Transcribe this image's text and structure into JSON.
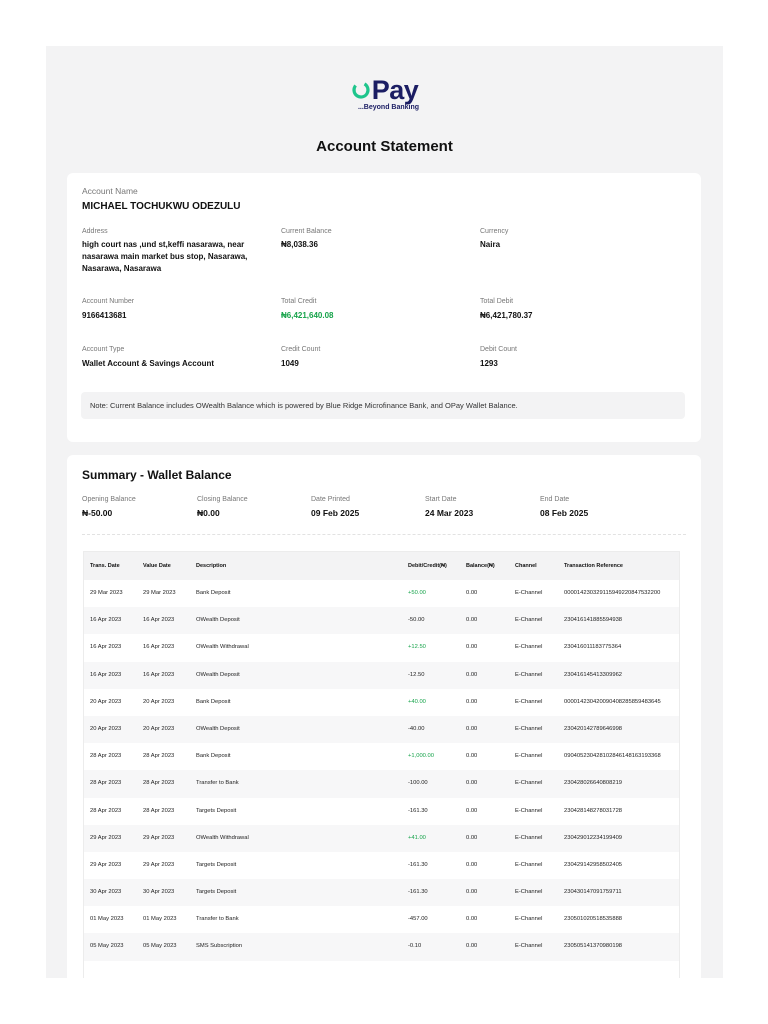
{
  "logo": {
    "word": "Pay",
    "tagline": "...Beyond Banking",
    "brand_color": "#1b1d63",
    "accent_color": "#1ec58c"
  },
  "page_title": "Account Statement",
  "account": {
    "name_label": "Account Name",
    "name": "MICHAEL TOCHUKWU ODEZULU",
    "address_label": "Address",
    "address_lines": [
      "high court nas ,und st,keffi nasarawa, near",
      "nasarawa main market bus stop, Nasarawa,",
      "Nasarawa, Nasarawa"
    ],
    "current_balance_label": "Current Balance",
    "current_balance": "₦8,038.36",
    "currency_label": "Currency",
    "currency": "Naira",
    "account_number_label": "Account Number",
    "account_number": "9166413681",
    "total_credit_label": "Total Credit",
    "total_credit": "₦6,421,640.08",
    "total_debit_label": "Total Debit",
    "total_debit": "₦6,421,780.37",
    "account_type_label": "Account Type",
    "account_type": "Wallet Account & Savings Account",
    "credit_count_label": "Credit Count",
    "credit_count": "1049",
    "debit_count_label": "Debit Count",
    "debit_count": "1293",
    "note": "Note: Current Balance includes OWealth Balance which is powered by Blue Ridge Microfinance Bank, and OPay Wallet Balance."
  },
  "summary": {
    "title": "Summary - Wallet Balance",
    "opening_balance_label": "Opening Balance",
    "opening_balance": "₦-50.00",
    "closing_balance_label": "Closing Balance",
    "closing_balance": "₦0.00",
    "date_printed_label": "Date Printed",
    "date_printed": "09 Feb 2025",
    "start_date_label": "Start Date",
    "start_date": "24 Mar 2023",
    "end_date_label": "End Date",
    "end_date": "08 Feb 2025"
  },
  "table": {
    "headers": [
      "Trans. Date",
      "Value Date",
      "Description",
      "Debit/Credit(₦)",
      "Balance(₦)",
      "Channel",
      "Transaction Reference"
    ],
    "rows": [
      {
        "trans_date": "29 Mar 2023",
        "value_date": "29 Mar 2023",
        "description": "Bank Deposit",
        "amount": "+50.00",
        "balance": "0.00",
        "channel": "E-Channel",
        "reference": "000014230329115949220847532200",
        "credit": true
      },
      {
        "trans_date": "16 Apr 2023",
        "value_date": "16 Apr 2023",
        "description": "OWealth Deposit",
        "amount": "-50.00",
        "balance": "0.00",
        "channel": "E-Channel",
        "reference": "230416141885594938",
        "credit": false
      },
      {
        "trans_date": "16 Apr 2023",
        "value_date": "16 Apr 2023",
        "description": "OWealth Withdrawal",
        "amount": "+12.50",
        "balance": "0.00",
        "channel": "E-Channel",
        "reference": "230416011183775364",
        "credit": true
      },
      {
        "trans_date": "16 Apr 2023",
        "value_date": "16 Apr 2023",
        "description": "OWealth Deposit",
        "amount": "-12.50",
        "balance": "0.00",
        "channel": "E-Channel",
        "reference": "230416145413309962",
        "credit": false
      },
      {
        "trans_date": "20 Apr 2023",
        "value_date": "20 Apr 2023",
        "description": "Bank Deposit",
        "amount": "+40.00",
        "balance": "0.00",
        "channel": "E-Channel",
        "reference": "000014230420090408285859483645",
        "credit": true
      },
      {
        "trans_date": "20 Apr 2023",
        "value_date": "20 Apr 2023",
        "description": "OWealth Deposit",
        "amount": "-40.00",
        "balance": "0.00",
        "channel": "E-Channel",
        "reference": "230420142789646998",
        "credit": false
      },
      {
        "trans_date": "28 Apr 2023",
        "value_date": "28 Apr 2023",
        "description": "Bank Deposit",
        "amount": "+1,000.00",
        "balance": "0.00",
        "channel": "E-Channel",
        "reference": "090405230428102846148163193368",
        "credit": true
      },
      {
        "trans_date": "28 Apr 2023",
        "value_date": "28 Apr 2023",
        "description": "Transfer to Bank",
        "amount": "-100.00",
        "balance": "0.00",
        "channel": "E-Channel",
        "reference": "230428026640808219",
        "credit": false
      },
      {
        "trans_date": "28 Apr 2023",
        "value_date": "28 Apr 2023",
        "description": "Targets Deposit",
        "amount": "-161.30",
        "balance": "0.00",
        "channel": "E-Channel",
        "reference": "230428148278031728",
        "credit": false
      },
      {
        "trans_date": "29 Apr 2023",
        "value_date": "29 Apr 2023",
        "description": "OWealth Withdrawal",
        "amount": "+41.00",
        "balance": "0.00",
        "channel": "E-Channel",
        "reference": "230429012234199409",
        "credit": true
      },
      {
        "trans_date": "29 Apr 2023",
        "value_date": "29 Apr 2023",
        "description": "Targets Deposit",
        "amount": "-161.30",
        "balance": "0.00",
        "channel": "E-Channel",
        "reference": "230429142958502405",
        "credit": false
      },
      {
        "trans_date": "30 Apr 2023",
        "value_date": "30 Apr 2023",
        "description": "Targets Deposit",
        "amount": "-161.30",
        "balance": "0.00",
        "channel": "E-Channel",
        "reference": "230430147091759711",
        "credit": false
      },
      {
        "trans_date": "01 May 2023",
        "value_date": "01 May 2023",
        "description": "Transfer to Bank",
        "amount": "-457.00",
        "balance": "0.00",
        "channel": "E-Channel",
        "reference": "230501020518535888",
        "credit": false
      },
      {
        "trans_date": "05 May 2023",
        "value_date": "05 May 2023",
        "description": "SMS Subscription",
        "amount": "-0.10",
        "balance": "0.00",
        "channel": "E-Channel",
        "reference": "230505141370980198",
        "credit": false
      }
    ]
  }
}
